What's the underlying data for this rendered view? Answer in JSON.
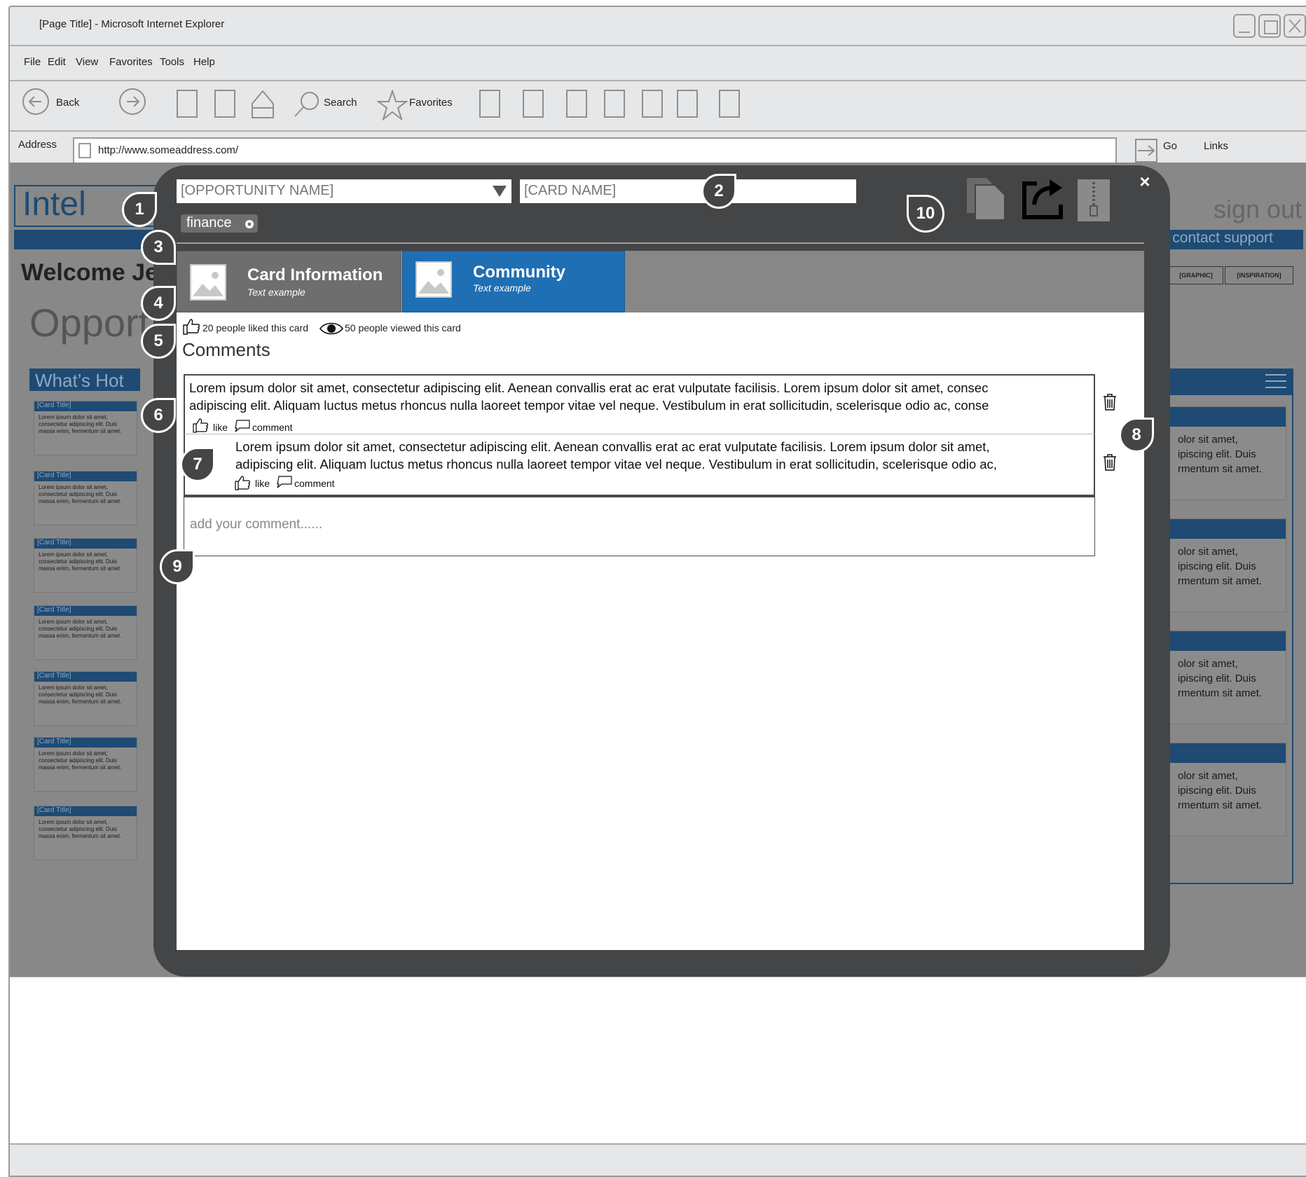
{
  "window": {
    "title": "[Page Title] - Microsoft Internet Explorer"
  },
  "menu": {
    "items": [
      "File",
      "Edit",
      "View",
      "Favorites",
      "Tools",
      "Help"
    ]
  },
  "toolbar": {
    "back_label": "Back",
    "search_label": "Search",
    "favorites_label": "Favorites"
  },
  "addressbar": {
    "label": "Address",
    "url": "http://www.someaddress.com/",
    "go_label": "Go",
    "links_label": "Links"
  },
  "background_page": {
    "logo_text": "Intel",
    "welcome_text": "Welcome Je",
    "section_title": "Opport",
    "whats_hot": "What’s Hot",
    "sign_out": "sign out",
    "nav_text": "es  | contact support",
    "tag_1": "[GRAPHIC]",
    "tag_2": "[INSPIRATION]",
    "card_title": "[Card Title]",
    "card_text": "Lorem ipsum dolor sit amet, consectetur adipiscing elit. Duis massa enim, fermentum sit amet.",
    "right_card_lines": [
      "olor sit amet,",
      "ipiscing elit. Duis",
      "rmentum sit amet."
    ]
  },
  "modal": {
    "opportunity_placeholder": "[OPPORTUNITY NAME]",
    "card_name_placeholder": "[CARD NAME]",
    "tag": "finance",
    "tabs": [
      {
        "title": "Card Information",
        "subtitle": "Text example"
      },
      {
        "title": "Community",
        "subtitle": "Text example"
      }
    ],
    "stats": {
      "likes_text": "20 people liked this card",
      "views_text": "50 people viewed this card"
    },
    "comments_heading": "Comments",
    "comments": [
      {
        "line1": "Lorem ipsum dolor sit amet, consectetur adipiscing elit. Aenean convallis erat ac erat vulputate facilisis. Lorem ipsum dolor sit amet, consec",
        "line2": "adipiscing elit. Aliquam luctus metus rhoncus nulla laoreet tempor vitae vel neque. Vestibulum in erat sollicitudin, scelerisque odio ac, conse"
      },
      {
        "line1": "Lorem ipsum dolor sit amet, consectetur adipiscing elit. Aenean convallis erat ac erat vulputate facilisis. Lorem ipsum dolor sit amet,",
        "line2": "adipiscing elit. Aliquam luctus metus rhoncus nulla laoreet tempor vitae vel neque. Vestibulum in erat sollicitudin, scelerisque odio ac,"
      }
    ],
    "like_label": "like",
    "comment_label": "comment",
    "add_comment_placeholder": "add your comment......",
    "close_symbol": "×"
  },
  "callouts": [
    "1",
    "2",
    "3",
    "4",
    "5",
    "6",
    "7",
    "8",
    "9",
    "10"
  ],
  "colors": {
    "modal_bg": "#444546",
    "active_tab": "#1f6fb5",
    "inactive_tab": "#6e6e6e",
    "header_blue": "#1e4a73"
  }
}
